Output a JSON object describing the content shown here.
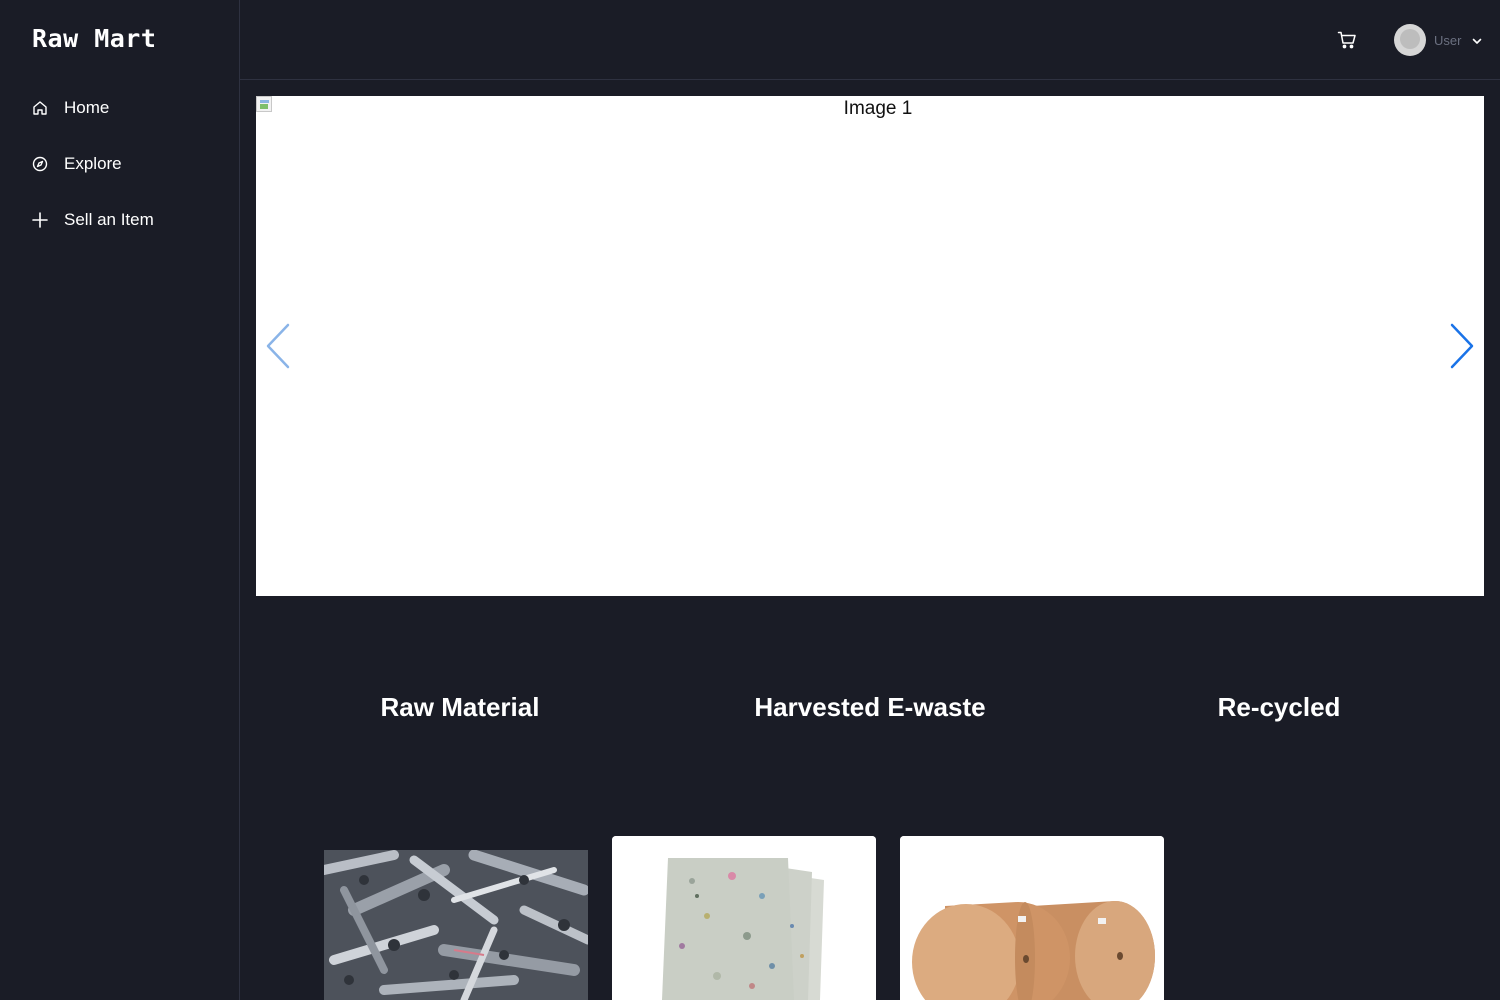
{
  "brand": {
    "name": "Raw Mart"
  },
  "sidebar": {
    "items": [
      {
        "label": "Home",
        "icon": "home-icon"
      },
      {
        "label": "Explore",
        "icon": "compass-icon"
      },
      {
        "label": "Sell an Item",
        "icon": "plus-icon"
      }
    ]
  },
  "header": {
    "cart_icon": "shopping-cart-icon",
    "user": {
      "name": "User",
      "avatar_icon": "avatar-icon",
      "dropdown_icon": "chevron-down-icon"
    }
  },
  "carousel": {
    "image_alt": "Image 1",
    "prev_icon": "chevron-left-icon",
    "next_icon": "chevron-right-icon",
    "prev_color": "#8ab4e8",
    "next_color": "#1a73e8"
  },
  "categories": [
    {
      "label": "Raw Material"
    },
    {
      "label": "Harvested E-waste"
    },
    {
      "label": "Re-cycled"
    }
  ],
  "products": [
    {
      "image": "scrap-metal-pipes"
    },
    {
      "image": "recycled-foam-boards"
    },
    {
      "image": "kraft-paper-rolls"
    }
  ],
  "colors": {
    "background": "#1a1c26",
    "border": "#2e3140",
    "text": "#ffffff"
  }
}
